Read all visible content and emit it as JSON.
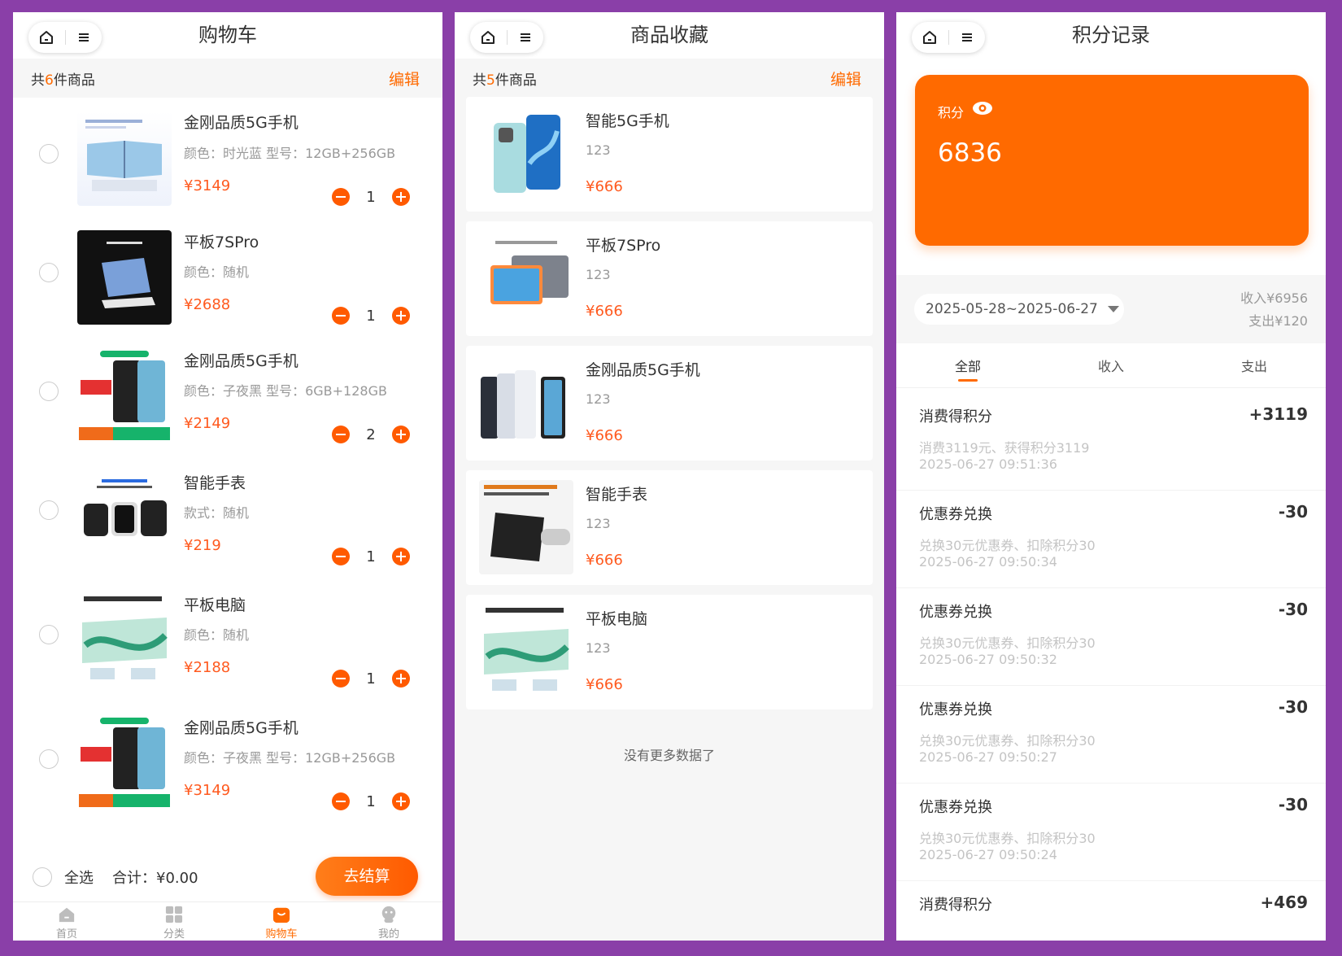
{
  "colors": {
    "accent": "#ff6a00",
    "price": "#ff5a1f",
    "frame": "#8a3fa8"
  },
  "icons": [
    "home-icon",
    "menu-icon",
    "eye-icon",
    "tab-home-icon",
    "tab-category-icon",
    "tab-cart-icon",
    "tab-profile-icon"
  ],
  "cart": {
    "title": "购物车",
    "count_prefix": "共",
    "count": "6",
    "count_suffix": "件商品",
    "edit": "编辑",
    "items": [
      {
        "name": "金刚品质5G手机",
        "spec": "颜色：时光蓝 型号：12GB+256GB",
        "price": "¥3149",
        "qty": "1"
      },
      {
        "name": "平板7SPro",
        "spec": "颜色：随机",
        "price": "¥2688",
        "qty": "1"
      },
      {
        "name": "金刚品质5G手机",
        "spec": "颜色：子夜黑 型号：6GB+128GB",
        "price": "¥2149",
        "qty": "2"
      },
      {
        "name": "智能手表",
        "spec": "款式：随机",
        "price": "¥219",
        "qty": "1"
      },
      {
        "name": "平板电脑",
        "spec": "颜色：随机",
        "price": "¥2188",
        "qty": "1"
      },
      {
        "name": "金刚品质5G手机",
        "spec": "颜色：子夜黑 型号：12GB+256GB",
        "price": "¥3149",
        "qty": "1"
      }
    ],
    "select_all": "全选",
    "total_label": "合计：",
    "total_value": "¥0.00",
    "checkout": "去结算",
    "tabs": [
      "首页",
      "分类",
      "购物车",
      "我的"
    ]
  },
  "favorites": {
    "title": "商品收藏",
    "count_prefix": "共",
    "count": "5",
    "count_suffix": "件商品",
    "edit": "编辑",
    "items": [
      {
        "name": "智能5G手机",
        "desc": "123",
        "price": "¥666"
      },
      {
        "name": "平板7SPro",
        "desc": "123",
        "price": "¥666"
      },
      {
        "name": "金刚品质5G手机",
        "desc": "123",
        "price": "¥666"
      },
      {
        "name": "智能手表",
        "desc": "123",
        "price": "¥666"
      },
      {
        "name": "平板电脑",
        "desc": "123",
        "price": "¥666"
      }
    ],
    "no_more": "没有更多数据了"
  },
  "points": {
    "title": "积分记录",
    "card_label": "积分",
    "card_value": "6836",
    "date_range": "2025-05-28~2025-06-27",
    "income": "收入¥6956",
    "expense": "支出¥120",
    "tabs": [
      "全部",
      "收入",
      "支出"
    ],
    "records": [
      {
        "title": "消费得积分",
        "amount": "+3119",
        "desc": "消费3119元、获得积分3119",
        "time": "2025-06-27 09:51:36"
      },
      {
        "title": "优惠券兑换",
        "amount": "-30",
        "desc": "兑换30元优惠券、扣除积分30",
        "time": "2025-06-27 09:50:34"
      },
      {
        "title": "优惠券兑换",
        "amount": "-30",
        "desc": "兑换30元优惠券、扣除积分30",
        "time": "2025-06-27 09:50:32"
      },
      {
        "title": "优惠券兑换",
        "amount": "-30",
        "desc": "兑换30元优惠券、扣除积分30",
        "time": "2025-06-27 09:50:27"
      },
      {
        "title": "优惠券兑换",
        "amount": "-30",
        "desc": "兑换30元优惠券、扣除积分30",
        "time": "2025-06-27 09:50:24"
      },
      {
        "title": "消费得积分",
        "amount": "+469"
      }
    ]
  }
}
